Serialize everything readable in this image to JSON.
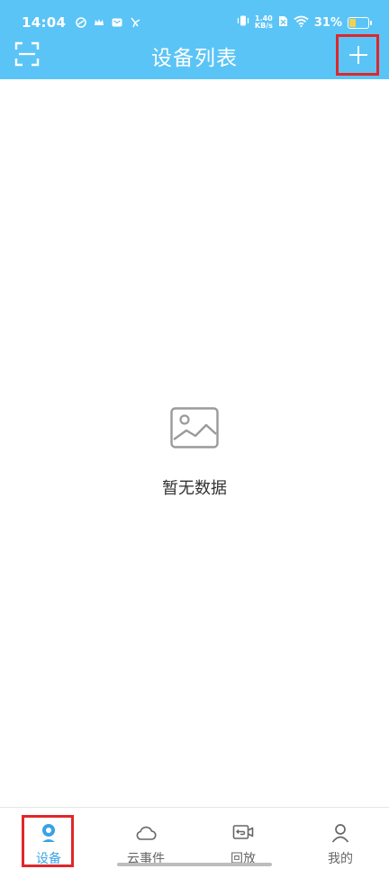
{
  "status_bar": {
    "time": "14:04",
    "net_speed_value": "1.40",
    "net_speed_unit": "KB/s",
    "battery_percent": "31%",
    "battery_level": 0.31
  },
  "header": {
    "title": "设备列表",
    "scan_icon": "scan-icon",
    "add_icon": "plus-icon",
    "background": "#5bc4f6"
  },
  "empty_state": {
    "icon": "image-placeholder-icon",
    "text": "暂无数据"
  },
  "tabbar": {
    "tabs": [
      {
        "label": "设备",
        "icon": "device-icon",
        "active": true
      },
      {
        "label": "云事件",
        "icon": "cloud-icon",
        "active": false
      },
      {
        "label": "回放",
        "icon": "playback-icon",
        "active": false
      },
      {
        "label": "我的",
        "icon": "profile-icon",
        "active": false
      }
    ],
    "active_color": "#3aa2e6"
  },
  "highlight_color": "#e0262b"
}
